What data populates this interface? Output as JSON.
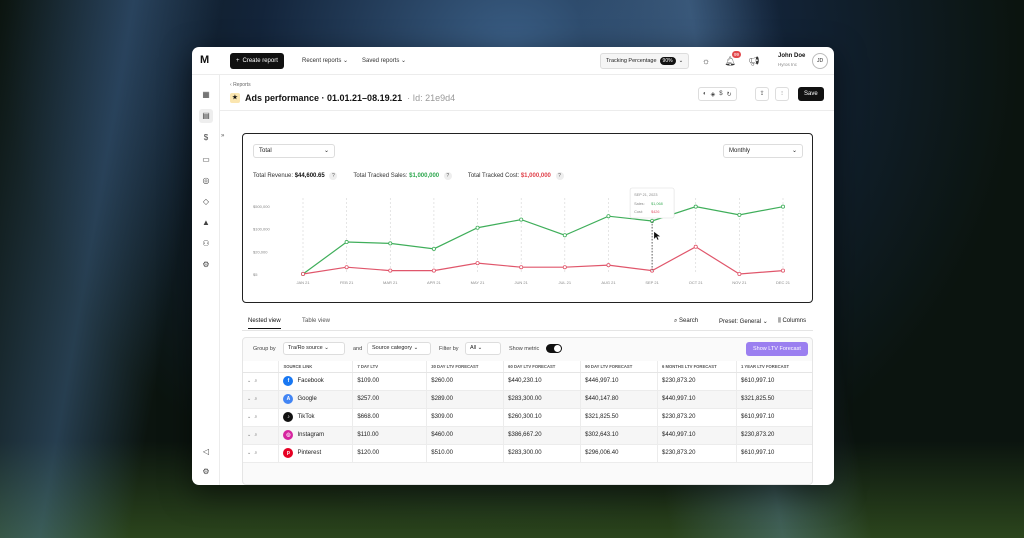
{
  "topbar": {
    "logo": "M",
    "create_label": "Create report",
    "recent_label": "Recent reports",
    "saved_label": "Saved reports",
    "tracking_label": "Tracking Percentage",
    "tracking_value": "90%",
    "notif_count": "99",
    "user_name": "John Doe",
    "user_org": "Hyros Inc",
    "user_initials": "JD"
  },
  "header": {
    "breadcrumb": "Reports",
    "title": "Ads performance · 01.01.21–08.19.21",
    "id": "· Id: 21e9d4",
    "save_label": "Save",
    "collapse_icon": "chevrons-right-icon"
  },
  "chart_controls": {
    "group_select": "Total",
    "period_select": "Monthly"
  },
  "metrics": {
    "revenue_label": "Total Revenue:",
    "revenue_value": "$44,600.65",
    "sales_label": "Total Tracked Sales:",
    "sales_value": "$1,000,000",
    "cost_label": "Total Tracked Cost:",
    "cost_value": "$1,000,000",
    "help": "?"
  },
  "chart_data": {
    "type": "line",
    "categories": [
      "JAN 21",
      "FEB 21",
      "MAR 21",
      "APR 21",
      "MAY 21",
      "JUN 21",
      "JUL 21",
      "AUG 21",
      "SEP 21",
      "OCT 21",
      "NOV 21",
      "DEC 21"
    ],
    "y_ticks": [
      "$500,000",
      "$100,000",
      "$20,000",
      "$5"
    ],
    "series": [
      {
        "name": "Sales",
        "color": "#3fae5a",
        "values": [
          0.0,
          0.47,
          0.45,
          0.37,
          0.68,
          0.8,
          0.57,
          0.85,
          0.78,
          0.99,
          0.87,
          0.99
        ]
      },
      {
        "name": "Cost",
        "color": "#e0566b",
        "values": [
          0.0,
          0.1,
          0.05,
          0.05,
          0.16,
          0.1,
          0.1,
          0.13,
          0.05,
          0.4,
          0.0,
          0.05
        ]
      }
    ],
    "tooltip": {
      "title": "SEP 21, 2023",
      "sales_label": "Sales:",
      "sales_value": "$1,068",
      "cost_label": "Cost:",
      "cost_value": "$426"
    }
  },
  "tabs": [
    "Nested view",
    "Table view"
  ],
  "tools": {
    "search": "Search",
    "preset": "Preset: General",
    "columns": "Columns"
  },
  "filters": {
    "group_by_label": "Group by",
    "group_by_value": "Tra/Ro source",
    "and_label": "and",
    "and_value": "Source category",
    "filter_label": "Filter by",
    "filter_value": "All",
    "show_metric_label": "Show metric",
    "forecast_button": "Show LTV Forecast"
  },
  "table": {
    "columns": [
      "SOURCE LINK",
      "7 DAY LTV",
      "30 DAY LTV FORECAST",
      "60 DAY LTV FORECAST",
      "90 DAY LTV FORECAST",
      "6 MONTHS LTV FORECAST",
      "1 YEAR LTV FORECAST"
    ],
    "rows": [
      {
        "source": "Facebook",
        "icon": "facebook-icon",
        "color": "#1877f2",
        "glyph": "f",
        "cells": [
          "$109.00",
          "$260.00",
          "$440,230.10",
          "$446,997.10",
          "$230,873.20",
          "$610,997.10"
        ]
      },
      {
        "source": "Google",
        "icon": "google-ads-icon",
        "color": "#4285f4",
        "glyph": "A",
        "cells": [
          "$257.00",
          "$289.00",
          "$283,300.00",
          "$440,147.80",
          "$440,997.10",
          "$321,825.50"
        ]
      },
      {
        "source": "TikTok",
        "icon": "tiktok-icon",
        "color": "#111111",
        "glyph": "♪",
        "cells": [
          "$668.00",
          "$309.00",
          "$260,300.10",
          "$321,825.50",
          "$230,873.20",
          "$610,997.10"
        ]
      },
      {
        "source": "Instagram",
        "icon": "instagram-icon",
        "color": "#d6249f",
        "glyph": "◎",
        "cells": [
          "$110.00",
          "$460.00",
          "$386,667.20",
          "$302,643.10",
          "$440,997.10",
          "$230,873.20"
        ]
      },
      {
        "source": "Pinterest",
        "icon": "pinterest-icon",
        "color": "#e60023",
        "glyph": "p",
        "cells": [
          "$120.00",
          "$510.00",
          "$283,300.00",
          "$296,006.40",
          "$230,873.20",
          "$610,997.10"
        ]
      }
    ]
  }
}
